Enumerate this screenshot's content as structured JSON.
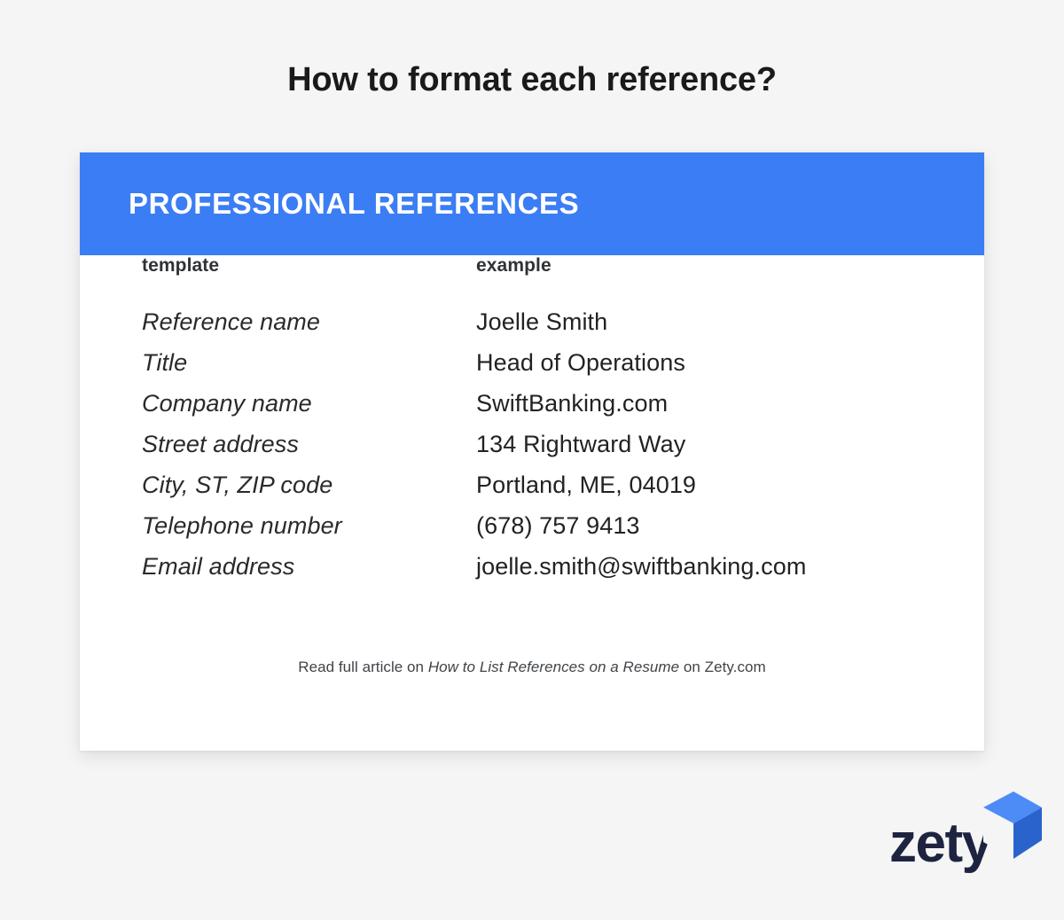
{
  "page": {
    "title": "How to format each reference?",
    "background_color": "#f5f5f5"
  },
  "card": {
    "header": {
      "title": "PROFESSIONAL REFERENCES",
      "background_color": "#3b7df4",
      "text_color": "#ffffff"
    },
    "columns": {
      "template_label": "template",
      "example_label": "example"
    },
    "rows": [
      {
        "template": "Reference name",
        "example": "Joelle Smith"
      },
      {
        "template": "Title",
        "example": "Head of Operations"
      },
      {
        "template": "Company name",
        "example": "SwiftBanking.com"
      },
      {
        "template": "Street address",
        "example": "134 Rightward Way"
      },
      {
        "template": "City, ST, ZIP code",
        "example": "Portland, ME, 04019"
      },
      {
        "template": "Telephone number",
        "example": "(678) 757 9413"
      },
      {
        "template": "Email address",
        "example": "joelle.smith@swiftbanking.com"
      }
    ],
    "footer": {
      "prefix": "Read full article on ",
      "article_title": "How to List References on a Resume",
      "suffix": " on Zety.com"
    }
  },
  "logo": {
    "wordmark": "zety",
    "wordmark_color": "#1e2440",
    "mark_color_light": "#3b7df4",
    "mark_color_dark": "#2b63cc"
  }
}
